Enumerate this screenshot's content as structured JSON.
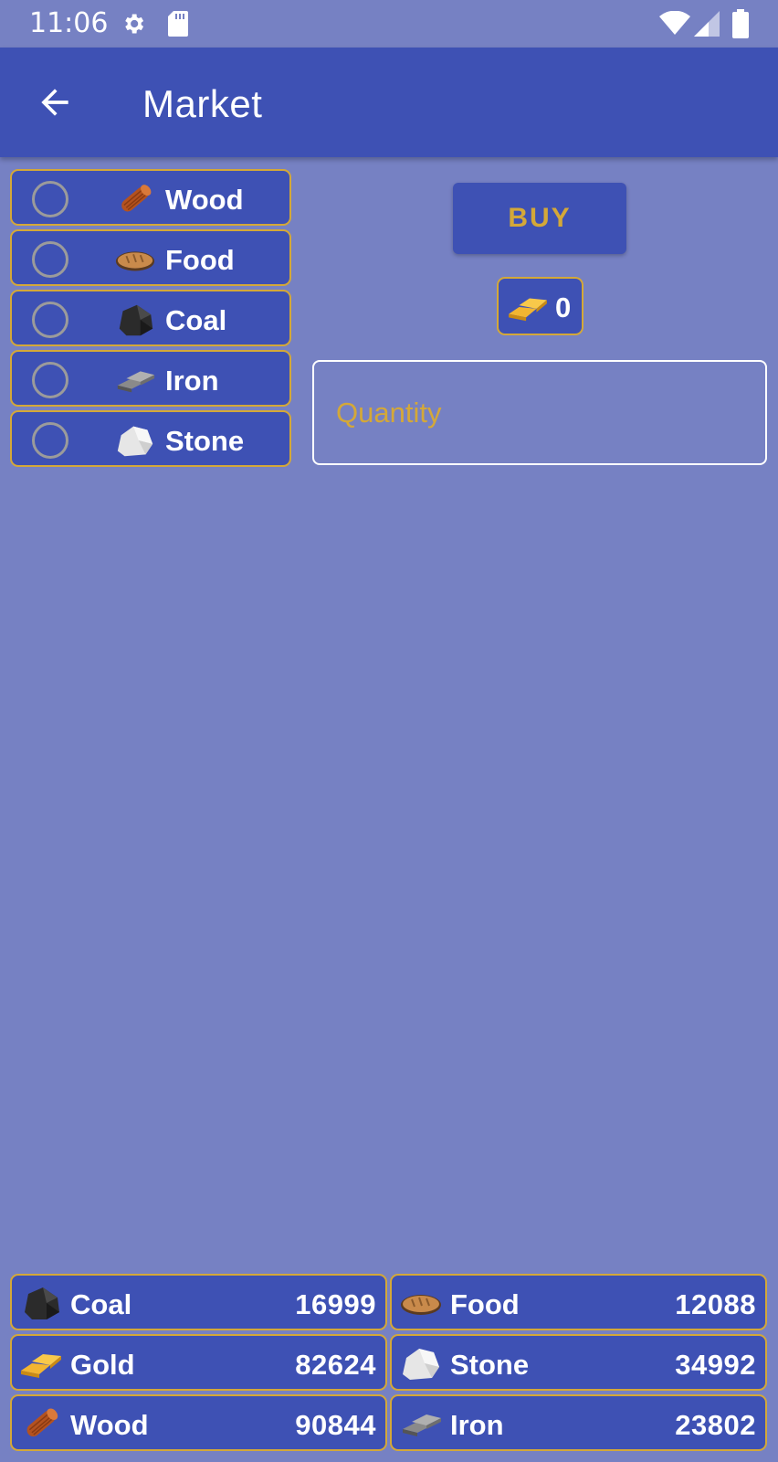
{
  "status_bar": {
    "time": "11:06"
  },
  "app_bar": {
    "title": "Market"
  },
  "resources": [
    {
      "label": "Wood",
      "icon": "wood-icon"
    },
    {
      "label": "Food",
      "icon": "bread-icon"
    },
    {
      "label": "Coal",
      "icon": "coal-icon"
    },
    {
      "label": "Iron",
      "icon": "iron-icon"
    },
    {
      "label": "Stone",
      "icon": "stone-icon"
    }
  ],
  "buy": {
    "label": "BUY",
    "price": "0",
    "quantity_placeholder": "Quantity"
  },
  "inventory": [
    {
      "name": "Coal",
      "count": "16999",
      "icon": "coal-icon"
    },
    {
      "name": "Food",
      "count": "12088",
      "icon": "bread-icon"
    },
    {
      "name": "Gold",
      "count": "82624",
      "icon": "gold-icon"
    },
    {
      "name": "Stone",
      "count": "34992",
      "icon": "stone-icon"
    },
    {
      "name": "Wood",
      "count": "90844",
      "icon": "wood-icon"
    },
    {
      "name": "Iron",
      "count": "23802",
      "icon": "iron-icon"
    }
  ],
  "colors": {
    "background": "#7681c3",
    "primary": "#3e51b4",
    "accent": "#d4a838"
  }
}
